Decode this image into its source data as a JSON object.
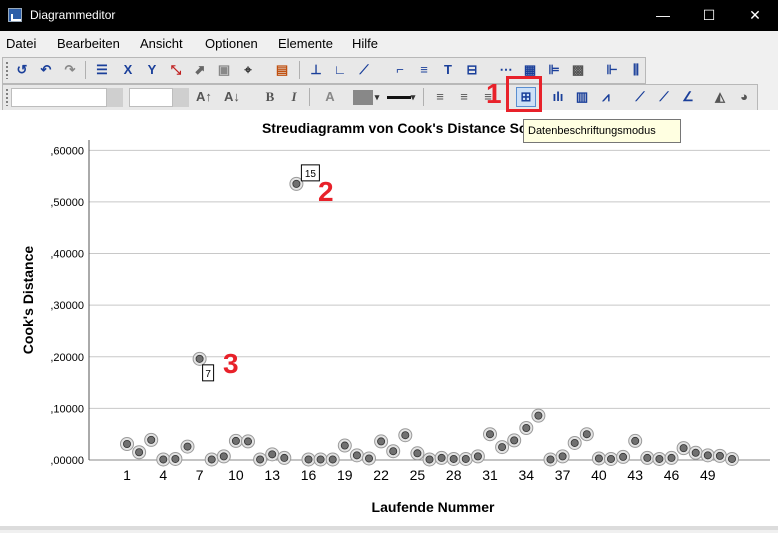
{
  "window": {
    "title": "Diagrammeditor",
    "minimize": "—",
    "maximize": "☐",
    "close": "✕"
  },
  "menu": [
    "Datei",
    "Bearbeiten",
    "Ansicht",
    "Optionen",
    "Elemente",
    "Hilfe"
  ],
  "format_toolbar": {
    "font_size_value": "",
    "bold": "B",
    "italic": "I"
  },
  "tooltip": "Datenbeschriftungsmodus",
  "annotations": [
    "1",
    "2",
    "3"
  ],
  "chart_data": {
    "type": "scatter",
    "title": "Streudiagramm von Cook's Distance Schritt: Lauf",
    "xlabel": "Laufende Nummer",
    "ylabel": "Cook's Distance",
    "ylim": [
      0,
      0.62
    ],
    "xlim": [
      0,
      52
    ],
    "x_ticks": [
      "1",
      "4",
      "7",
      "10",
      "13",
      "16",
      "19",
      "22",
      "25",
      "28",
      "31",
      "34",
      "37",
      "40",
      "43",
      "46",
      "49"
    ],
    "y_ticks": [
      ",00000",
      ",10000",
      ",20000",
      ",30000",
      ",40000",
      ",50000",
      ",60000"
    ],
    "grid": true,
    "points": [
      {
        "x": 1,
        "y": 0.031
      },
      {
        "x": 2,
        "y": 0.015
      },
      {
        "x": 3,
        "y": 0.039
      },
      {
        "x": 4,
        "y": 0.001
      },
      {
        "x": 5,
        "y": 0.002
      },
      {
        "x": 6,
        "y": 0.026
      },
      {
        "x": 7,
        "y": 0.196
      },
      {
        "x": 8,
        "y": 0.001
      },
      {
        "x": 9,
        "y": 0.007
      },
      {
        "x": 10,
        "y": 0.037
      },
      {
        "x": 11,
        "y": 0.036
      },
      {
        "x": 12,
        "y": 0.001
      },
      {
        "x": 13,
        "y": 0.011
      },
      {
        "x": 14,
        "y": 0.004
      },
      {
        "x": 15,
        "y": 0.535
      },
      {
        "x": 16,
        "y": 0.001
      },
      {
        "x": 17,
        "y": 0.001
      },
      {
        "x": 18,
        "y": 0.001
      },
      {
        "x": 19,
        "y": 0.028
      },
      {
        "x": 20,
        "y": 0.009
      },
      {
        "x": 21,
        "y": 0.003
      },
      {
        "x": 22,
        "y": 0.036
      },
      {
        "x": 23,
        "y": 0.017
      },
      {
        "x": 24,
        "y": 0.048
      },
      {
        "x": 25,
        "y": 0.013
      },
      {
        "x": 26,
        "y": 0.001
      },
      {
        "x": 27,
        "y": 0.004
      },
      {
        "x": 28,
        "y": 0.002
      },
      {
        "x": 29,
        "y": 0.002
      },
      {
        "x": 30,
        "y": 0.007
      },
      {
        "x": 31,
        "y": 0.05
      },
      {
        "x": 32,
        "y": 0.025
      },
      {
        "x": 33,
        "y": 0.038
      },
      {
        "x": 34,
        "y": 0.062
      },
      {
        "x": 35,
        "y": 0.086
      },
      {
        "x": 36,
        "y": 0.001
      },
      {
        "x": 37,
        "y": 0.007
      },
      {
        "x": 38,
        "y": 0.033
      },
      {
        "x": 39,
        "y": 0.05
      },
      {
        "x": 40,
        "y": 0.003
      },
      {
        "x": 41,
        "y": 0.002
      },
      {
        "x": 42,
        "y": 0.006
      },
      {
        "x": 43,
        "y": 0.037
      },
      {
        "x": 44,
        "y": 0.004
      },
      {
        "x": 45,
        "y": 0.002
      },
      {
        "x": 46,
        "y": 0.004
      },
      {
        "x": 47,
        "y": 0.023
      },
      {
        "x": 48,
        "y": 0.014
      },
      {
        "x": 49,
        "y": 0.009
      },
      {
        "x": 50,
        "y": 0.008
      },
      {
        "x": 51,
        "y": 0.002
      }
    ],
    "labeled_points": [
      {
        "x": 15,
        "label": "15"
      },
      {
        "x": 7,
        "label": "7"
      }
    ]
  }
}
